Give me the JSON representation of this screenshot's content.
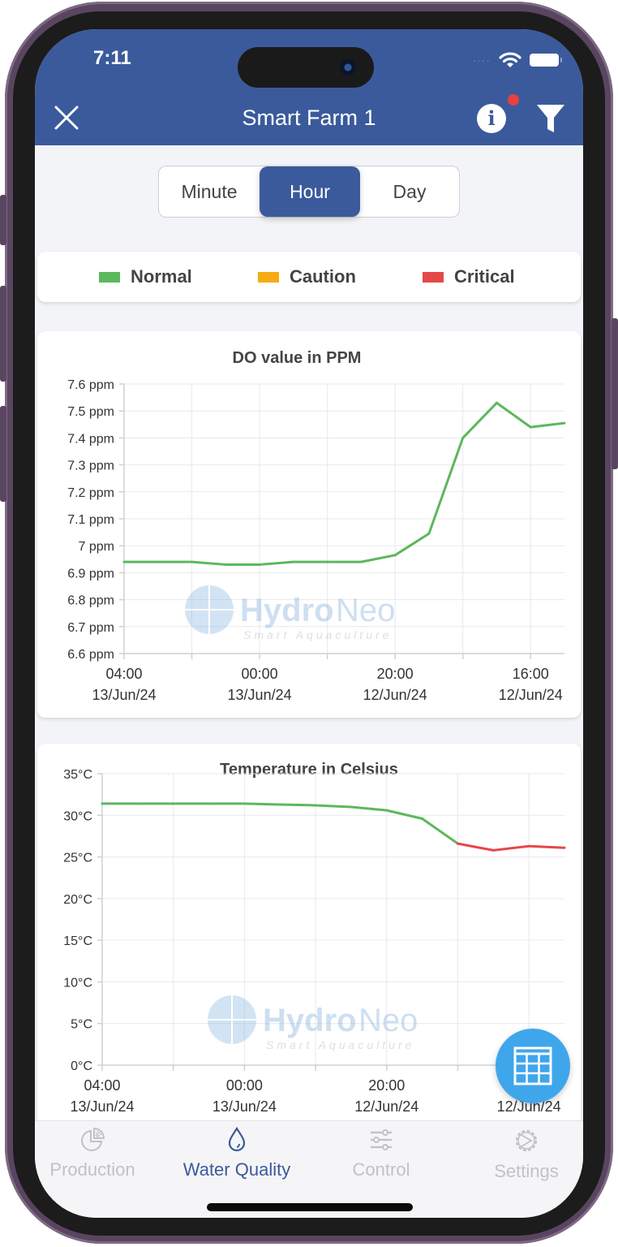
{
  "status_bar": {
    "time": "7:11",
    "signal": "····"
  },
  "app_bar": {
    "title": "Smart Farm 1",
    "close_icon": "close-icon",
    "info_icon": "info-icon",
    "info_badge": true,
    "filter_icon": "filter-icon"
  },
  "range_selector": {
    "options": [
      "Minute",
      "Hour",
      "Day"
    ],
    "selected": "Hour"
  },
  "legend": {
    "items": [
      {
        "label": "Normal",
        "color": "#5cb85c"
      },
      {
        "label": "Caution",
        "color": "#f6ab12"
      },
      {
        "label": "Critical",
        "color": "#e54848"
      }
    ]
  },
  "watermark": {
    "brand": "HydroNeo",
    "brand_part1": "Hydro",
    "brand_part2": "Neo",
    "tagline": "Smart Aquaculture"
  },
  "chart_data": [
    {
      "type": "line",
      "title": "DO value in PPM",
      "xlabel": "",
      "ylabel": "",
      "ylim": [
        6.6,
        7.6
      ],
      "y_ticks": [
        7.6,
        7.5,
        7.4,
        7.3,
        7.2,
        7.1,
        7.0,
        6.9,
        6.8,
        6.7,
        6.6
      ],
      "y_tick_labels": [
        "7.6 ppm",
        "7.5 ppm",
        "7.4 ppm",
        "7.3 ppm",
        "7.2 ppm",
        "7.1 ppm",
        "7 ppm",
        "6.9 ppm",
        "6.8 ppm",
        "6.7 ppm",
        "6.6 ppm"
      ],
      "x_tick_labels": [
        {
          "time": "04:00",
          "date": "13/Jun/24"
        },
        {
          "time": "00:00",
          "date": "13/Jun/24"
        },
        {
          "time": "20:00",
          "date": "12/Jun/24"
        },
        {
          "time": "16:00",
          "date": "12/Jun/24"
        }
      ],
      "x": [
        "04:00 13/Jun",
        "03:00",
        "02:00",
        "01:00",
        "00:00 13/Jun",
        "23:00",
        "22:00",
        "21:00",
        "20:00 12/Jun",
        "19:00",
        "18:00",
        "17:00",
        "16:00 12/Jun",
        "15:00"
      ],
      "grid": true,
      "series": [
        {
          "name": "DO",
          "values": [
            6.94,
            6.94,
            6.94,
            6.93,
            6.93,
            6.94,
            6.94,
            6.94,
            6.965,
            7.045,
            7.4,
            7.53,
            7.44,
            7.455
          ],
          "status": [
            "normal",
            "normal",
            "normal",
            "normal",
            "normal",
            "normal",
            "normal",
            "normal",
            "normal",
            "normal",
            "normal",
            "normal",
            "normal",
            "normal"
          ]
        }
      ]
    },
    {
      "type": "line",
      "title": "Temperature in Celsius",
      "xlabel": "",
      "ylabel": "",
      "ylim": [
        0,
        35
      ],
      "y_ticks": [
        35,
        30,
        25,
        20,
        15,
        10,
        5,
        0
      ],
      "y_tick_labels": [
        "35°C",
        "30°C",
        "25°C",
        "20°C",
        "15°C",
        "10°C",
        "5°C",
        "0°C"
      ],
      "x_tick_labels": [
        {
          "time": "04:00",
          "date": "13/Jun/24"
        },
        {
          "time": "00:00",
          "date": "13/Jun/24"
        },
        {
          "time": "20:00",
          "date": "12/Jun/24"
        },
        {
          "time": "",
          "date": "12/Jun/24"
        }
      ],
      "x": [
        "04:00 13/Jun",
        "03:00",
        "02:00",
        "01:00",
        "00:00 13/Jun",
        "23:00",
        "22:00",
        "21:00",
        "20:00 12/Jun",
        "19:00",
        "18:00",
        "17:00",
        "16:00 12/Jun",
        "15:00"
      ],
      "grid": true,
      "series": [
        {
          "name": "Temperature",
          "values": [
            31.4,
            31.4,
            31.4,
            31.4,
            31.4,
            31.3,
            31.2,
            31.0,
            30.6,
            29.6,
            26.6,
            25.8,
            26.3,
            26.1
          ],
          "status": [
            "normal",
            "normal",
            "normal",
            "normal",
            "normal",
            "normal",
            "normal",
            "normal",
            "normal",
            "normal",
            "critical",
            "critical",
            "critical",
            "critical"
          ]
        }
      ]
    }
  ],
  "fab": {
    "icon": "table-icon"
  },
  "bottom_nav": {
    "items": [
      {
        "label": "Production",
        "icon": "pie-chart-icon",
        "active": false
      },
      {
        "label": "Water Quality",
        "icon": "water-drop-icon",
        "active": true
      },
      {
        "label": "Control",
        "icon": "sliders-icon",
        "active": false
      },
      {
        "label": "Settings",
        "icon": "gear-icon",
        "active": false
      }
    ]
  }
}
